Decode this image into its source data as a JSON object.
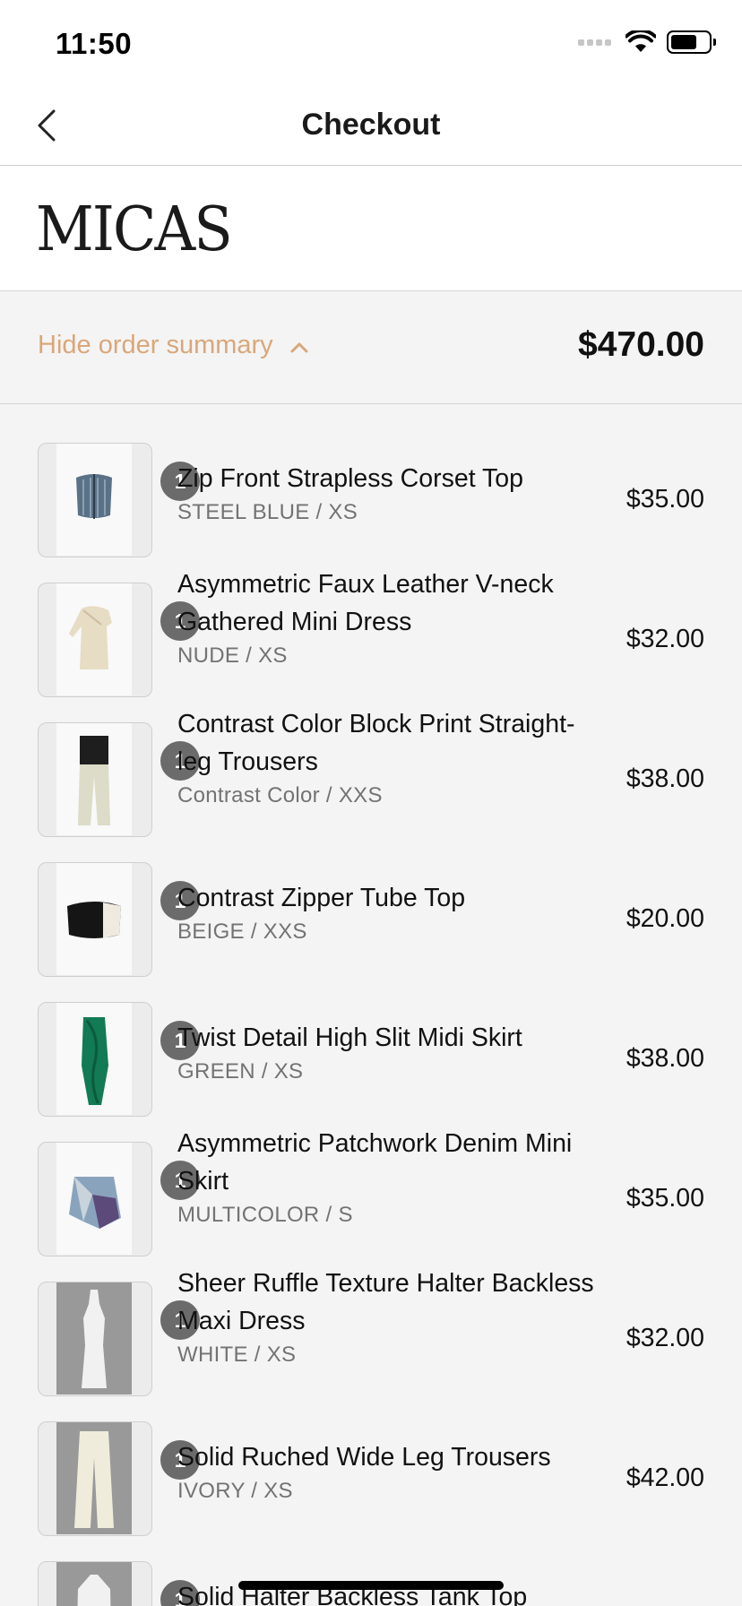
{
  "status_bar": {
    "time": "11:50"
  },
  "nav": {
    "title": "Checkout"
  },
  "brand": {
    "logo_text": "MICAS"
  },
  "summary": {
    "toggle_label": "Hide order summary",
    "total": "$470.00"
  },
  "items": [
    {
      "qty": "1",
      "name": "Zip Front Strapless Corset Top",
      "variant": "STEEL BLUE / XS",
      "price": "$35.00",
      "icon": "corset-top-image"
    },
    {
      "qty": "1",
      "name": "Asymmetric Faux Leather V-neck Gathered Mini Dress",
      "variant": "NUDE / XS",
      "price": "$32.00",
      "icon": "mini-dress-image"
    },
    {
      "qty": "1",
      "name": "Contrast Color Block Print Straight-leg Trousers",
      "variant": "Contrast Color / XXS",
      "price": "$38.00",
      "icon": "trousers-image"
    },
    {
      "qty": "1",
      "name": "Contrast Zipper Tube Top",
      "variant": "BEIGE / XXS",
      "price": "$20.00",
      "icon": "tube-top-image"
    },
    {
      "qty": "1",
      "name": "Twist Detail High Slit Midi Skirt",
      "variant": "GREEN / XS",
      "price": "$38.00",
      "icon": "midi-skirt-image"
    },
    {
      "qty": "1",
      "name": "Asymmetric Patchwork Denim Mini Skirt",
      "variant": "MULTICOLOR / S",
      "price": "$35.00",
      "icon": "denim-skirt-image"
    },
    {
      "qty": "1",
      "name": "Sheer Ruffle Texture Halter Backless Maxi Dress",
      "variant": "WHITE / XS",
      "price": "$32.00",
      "icon": "maxi-dress-image"
    },
    {
      "qty": "1",
      "name": "Solid Ruched Wide Leg Trousers",
      "variant": "IVORY / XS",
      "price": "$42.00",
      "icon": "wide-leg-trousers-image"
    },
    {
      "qty": "1",
      "name": "Solid Halter Backless Tank Top",
      "variant": "",
      "price": "",
      "icon": "tank-top-image"
    }
  ],
  "colors": {
    "accent": "#d9a77a",
    "badge": "#6b6b6b",
    "background": "#f4f4f4"
  }
}
